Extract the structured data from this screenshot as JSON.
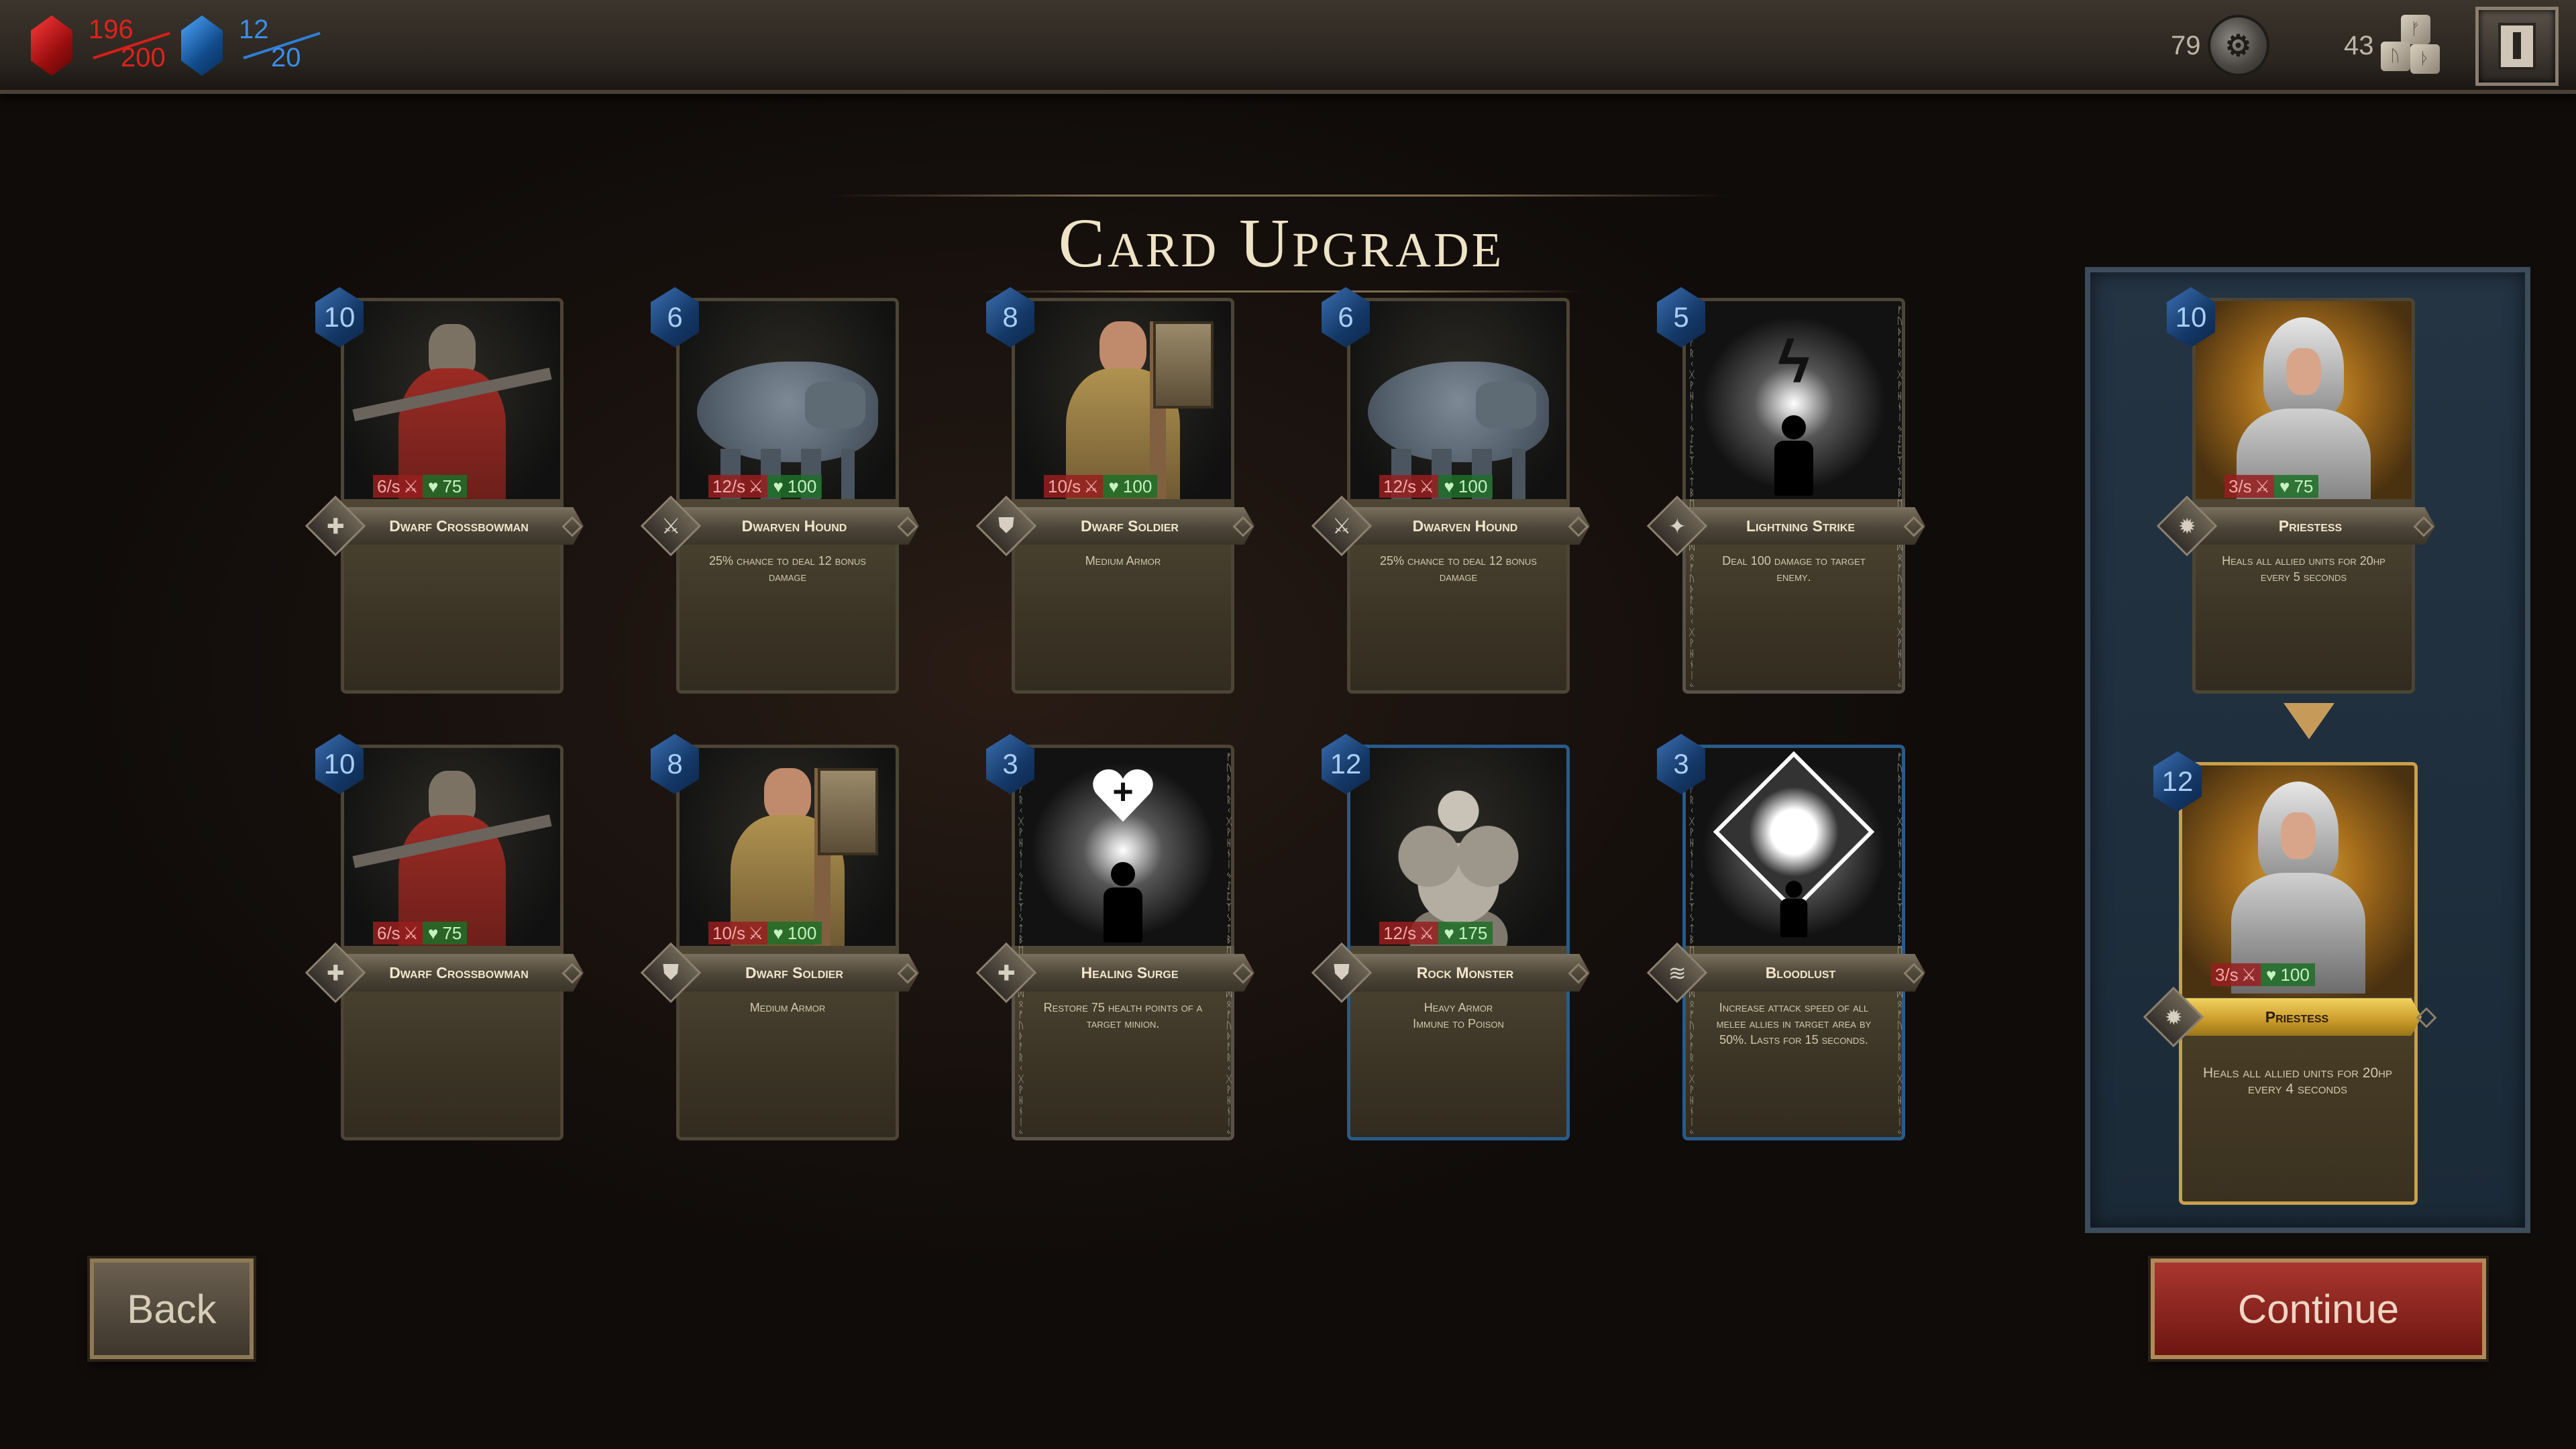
{
  "hud": {
    "health": {
      "current": "196",
      "max": "200",
      "color": "#e0211c"
    },
    "mana": {
      "current": "12",
      "max": "20",
      "color": "#3b8ee8"
    },
    "coins": "79",
    "stones": "43",
    "stones_glyphs": [
      "ᚠ",
      "ᚢ",
      "ᚦ"
    ]
  },
  "title": "Card Upgrade",
  "cards": [
    {
      "cost": "10",
      "name": "Dwarf Crossbowman",
      "atk": "6/s",
      "hp": "75",
      "text": "",
      "type_icon": "crossbow-icon",
      "art": "crossbowman"
    },
    {
      "cost": "6",
      "name": "Dwarven Hound",
      "atk": "12/s",
      "hp": "100",
      "text": "25% chance to deal 12 bonus damage",
      "type_icon": "sword-icon",
      "art": "hound"
    },
    {
      "cost": "8",
      "name": "Dwarf Soldier",
      "atk": "10/s",
      "hp": "100",
      "text": "Medium Armor",
      "type_icon": "shield-icon",
      "art": "soldier"
    },
    {
      "cost": "6",
      "name": "Dwarven Hound",
      "atk": "12/s",
      "hp": "100",
      "text": "25% chance to deal 12 bonus damage",
      "type_icon": "sword-icon",
      "art": "hound"
    },
    {
      "cost": "5",
      "name": "Lightning Strike",
      "text": "Deal 100 damage to target enemy.",
      "type_icon": "spell-icon",
      "art": "lightning"
    },
    {
      "cost": "10",
      "name": "Dwarf Crossbowman",
      "atk": "6/s",
      "hp": "75",
      "text": "",
      "type_icon": "crossbow-icon",
      "art": "crossbowman"
    },
    {
      "cost": "8",
      "name": "Dwarf Soldier",
      "atk": "10/s",
      "hp": "100",
      "text": "Medium Armor",
      "type_icon": "shield-icon",
      "art": "soldier"
    },
    {
      "cost": "3",
      "name": "Healing Surge",
      "text": "Restore 75 health points of a target minion.",
      "type_icon": "cross-icon",
      "art": "heal"
    },
    {
      "cost": "12",
      "name": "Rock Monster",
      "atk": "12/s",
      "hp": "175",
      "text": "Heavy Armor\nImmune to Poison",
      "type_icon": "shield-icon",
      "art": "rock"
    },
    {
      "cost": "3",
      "name": "Bloodlust",
      "text": "Increase attack speed of all melee allies in target area by 50%. Lasts for 15 seconds.",
      "type_icon": "wifi-icon",
      "art": "bloodlust"
    }
  ],
  "upgrade": {
    "from": {
      "cost": "10",
      "name": "Priestess",
      "atk": "3/s",
      "hp": "75",
      "text": "Heals all allied units for 20hp every 5 seconds"
    },
    "to": {
      "cost": "12",
      "name": "Priestess",
      "atk": "3/s",
      "hp": "100",
      "text": "Heals all allied units for 20hp every 4 seconds"
    }
  },
  "buttons": {
    "back": "Back",
    "continue": "Continue"
  }
}
